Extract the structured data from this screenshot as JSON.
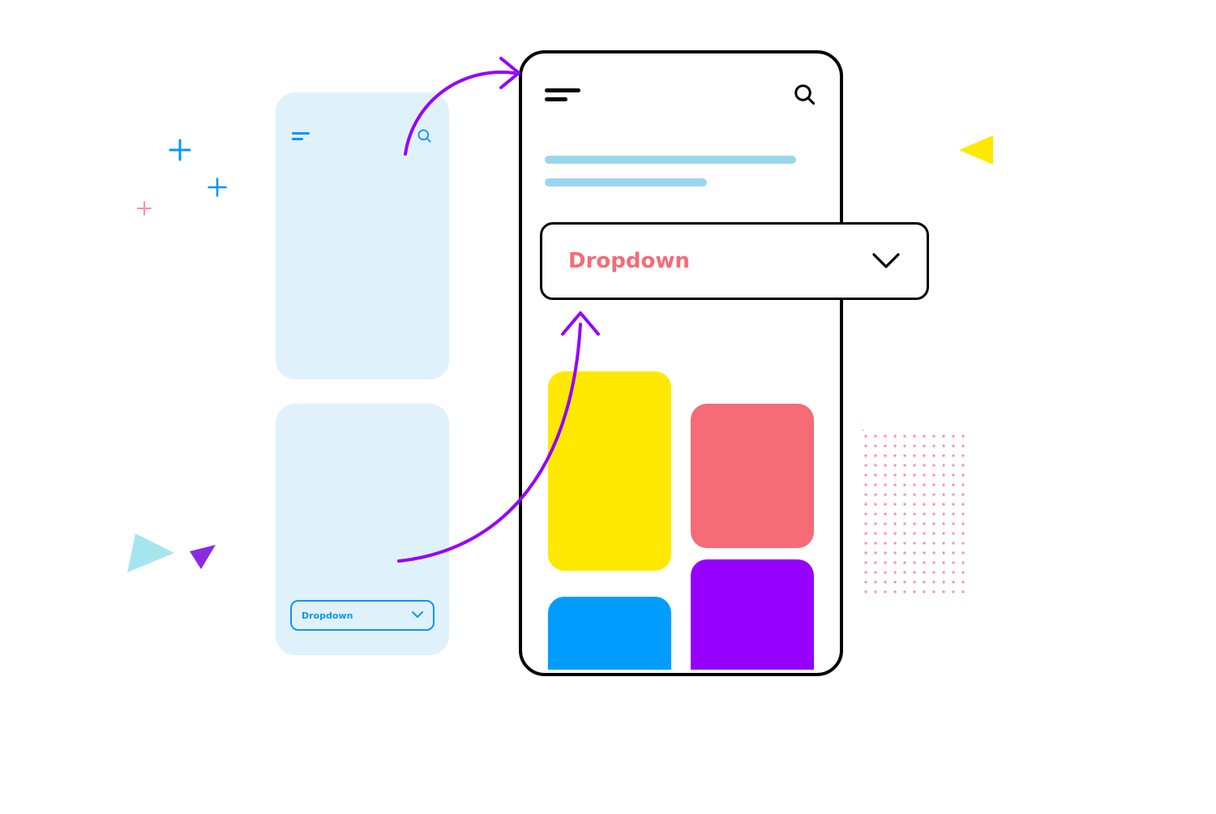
{
  "wireframe": {
    "dropdown_label": "Dropdown"
  },
  "phone": {
    "dropdown_label": "Dropdown"
  }
}
